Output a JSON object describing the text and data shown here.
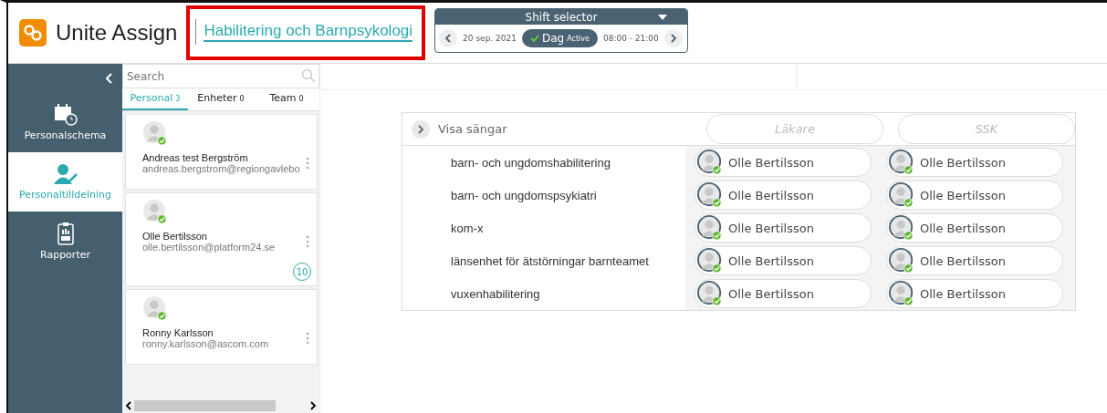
{
  "app": {
    "title": "Unite Assign",
    "department": "Habilitering och Barnpsykologi",
    "department_highlighted": true
  },
  "shift_selector": {
    "title": "Shift selector",
    "date": "20 sep. 2021",
    "shift": "Dag",
    "status": "Active",
    "hours": "08:00 - 21:00"
  },
  "sidebar": {
    "items": [
      {
        "label": "Personalschema",
        "kind": "calendar",
        "selected": false
      },
      {
        "label": "Personaltilldelning",
        "kind": "assign",
        "selected": true
      },
      {
        "label": "Rapporter",
        "kind": "report",
        "selected": false
      }
    ]
  },
  "search": {
    "placeholder": "Search"
  },
  "tabs": [
    {
      "label": "Personal",
      "count": "3",
      "selected": true
    },
    {
      "label": "Enheter",
      "count": "0",
      "selected": false
    },
    {
      "label": "Team",
      "count": "0",
      "selected": false
    }
  ],
  "staff": [
    {
      "name": "Andreas test Bergström",
      "email": "andreas.bergstrom@regiongavlebo",
      "online": true
    },
    {
      "name": "Olle Bertilsson",
      "email": "olle.bertilsson@platform24.se",
      "online": true,
      "badge": "10"
    },
    {
      "name": "Ronny Karlsson",
      "email": "ronny.karlsson@ascom.com",
      "online": true
    }
  ],
  "assignment": {
    "toggle": "Visa sängar",
    "columns": [
      "Läkare",
      "SSK"
    ],
    "rows": [
      {
        "unit": "barn- och ungdomshabilitering",
        "cells": [
          {
            "name": "Olle Bertilsson",
            "online": true
          },
          {
            "name": "Olle Bertilsson",
            "online": true
          }
        ]
      },
      {
        "unit": "barn- och ungdomspsykiatri",
        "cells": [
          {
            "name": "Olle Bertilsson",
            "online": true
          },
          {
            "name": "Olle Bertilsson",
            "online": true
          }
        ]
      },
      {
        "unit": "kom-x",
        "cells": [
          {
            "name": "Olle Bertilsson",
            "online": true
          },
          {
            "name": "Olle Bertilsson",
            "online": true
          }
        ]
      },
      {
        "unit": "länsenhet för ätstörningar barnteamet",
        "cells": [
          {
            "name": "Olle Bertilsson",
            "online": true
          },
          {
            "name": "Olle Bertilsson",
            "online": true
          }
        ]
      },
      {
        "unit": "vuxenhabilitering",
        "cells": [
          {
            "name": "Olle Bertilsson",
            "online": true
          },
          {
            "name": "Olle Bertilsson",
            "online": true
          }
        ]
      }
    ]
  }
}
